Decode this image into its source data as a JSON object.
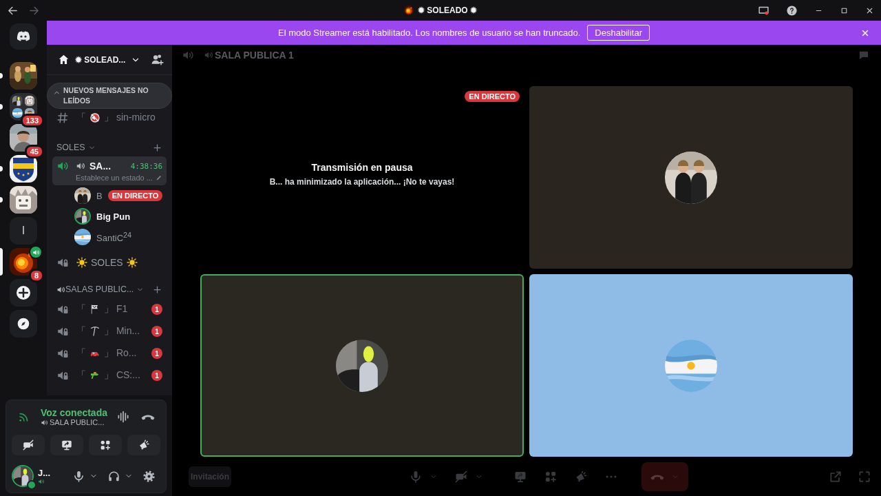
{
  "title_bar": {
    "title": "✹ SOLEADO ✹"
  },
  "banner": {
    "text": "El modo Streamer está habilitado. Los nombres de usuario se han truncado.",
    "button": "Deshabilitar"
  },
  "servers": [
    {
      "kind": "picture",
      "unread": true,
      "selected": false,
      "voice_active": false
    },
    {
      "kind": "folder",
      "unread": true,
      "selected": false,
      "voice_active": false,
      "badge": "133"
    },
    {
      "kind": "picture",
      "unread": false,
      "selected": false,
      "voice_active": false,
      "badge": "45"
    },
    {
      "kind": "picture",
      "unread": true,
      "selected": false,
      "voice_active": false
    },
    {
      "kind": "picture",
      "unread": true,
      "selected": false,
      "voice_active": false
    },
    {
      "kind": "letter",
      "label": "l",
      "unread": false,
      "selected": false,
      "voice_active": false
    },
    {
      "kind": "picture",
      "unread": false,
      "selected": true,
      "voice_active": true,
      "badge": "8"
    },
    {
      "kind": "add",
      "unread": false,
      "selected": false,
      "voice_active": false
    },
    {
      "kind": "explore",
      "unread": false,
      "selected": false,
      "voice_active": false
    }
  ],
  "server": {
    "name": "✹ SOLEAD..."
  },
  "unread_notice": "NUEVOS MENSAJES NO LEÍDOS",
  "text_channels": [
    {
      "open": "「",
      "close": "」",
      "name": "sin-micro"
    }
  ],
  "categories": [
    {
      "name": "SOLES",
      "channels": [
        {
          "kind": "active-voice",
          "name": "SA...",
          "time": "4:38:36",
          "status": "Establece un estado ...",
          "selected": true,
          "members": [
            {
              "name": "B",
              "speaking": false,
              "badge": "EN DIRECTO"
            },
            {
              "name": "Big Pun",
              "speaking": true
            },
            {
              "name": "SantiC$^{24}$",
              "speaking": false
            }
          ]
        },
        {
          "kind": "voice",
          "name": "SOLES",
          "selected": false
        }
      ]
    },
    {
      "name": "SALAS PUBLIC...",
      "channels": [
        {
          "kind": "room",
          "open": "「",
          "close": "」",
          "name": "F1",
          "badge": "1",
          "selected": false
        },
        {
          "kind": "room",
          "open": "「",
          "close": "」",
          "name": "Min...",
          "badge": "1",
          "selected": false
        },
        {
          "kind": "room",
          "open": "「",
          "close": "」",
          "name": "Ro...",
          "badge": "1",
          "selected": false
        },
        {
          "kind": "room",
          "open": "「",
          "close": "」",
          "name": "CS:...",
          "badge": "1",
          "selected": false
        }
      ]
    }
  ],
  "voice_panel": {
    "status": "Voz conectada",
    "channel": "SALA PUBLIC..."
  },
  "user": {
    "name": "J..."
  },
  "call": {
    "title": "SALA PUBLICA 1",
    "invite": "Invitación",
    "tiles": [
      {
        "kind": "stream",
        "live": "EN DIRECTO",
        "heading": "Transmisión en pausa",
        "message": "B... ha minimizado la aplicación... ¡No te vayas!",
        "speaking": false,
        "color": "#000000"
      },
      {
        "kind": "avatar",
        "speaking": false,
        "color": "#2b2520"
      },
      {
        "kind": "avatar",
        "speaking": true,
        "color": "#2a2820"
      },
      {
        "kind": "avatar",
        "speaking": false,
        "color": "#8fbce6"
      }
    ]
  }
}
